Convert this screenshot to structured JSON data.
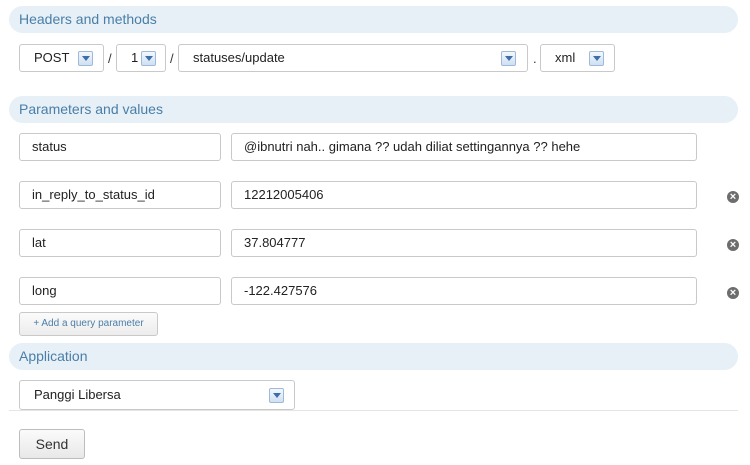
{
  "sections": {
    "headers": "Headers and methods",
    "params": "Parameters and values",
    "application": "Application"
  },
  "method": {
    "value": "POST"
  },
  "version": {
    "value": "1"
  },
  "endpoint": {
    "value": "statuses/update"
  },
  "format": {
    "value": "xml"
  },
  "separators": {
    "slash": "/",
    "dot": "."
  },
  "parameters": [
    {
      "name": "status",
      "value": "@ibnutri nah.. gimana ?? udah diliat settingannya ?? hehe"
    },
    {
      "name": "in_reply_to_status_id",
      "value": "12212005406"
    },
    {
      "name": "lat",
      "value": "37.804777"
    },
    {
      "name": "long",
      "value": "-122.427576"
    }
  ],
  "add_param_label": "+ Add a query parameter",
  "application": {
    "value": "Panggi Libersa"
  },
  "send_label": "Send",
  "icons": {
    "remove": "remove-circle-icon",
    "dropdown": "chevron-down-icon"
  }
}
